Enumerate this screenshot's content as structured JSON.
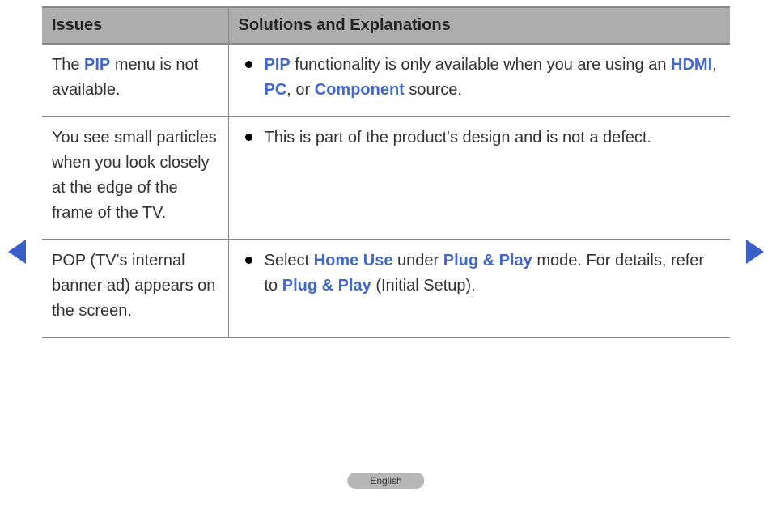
{
  "table": {
    "headers": {
      "issues": "Issues",
      "solutions": "Solutions and Explanations"
    },
    "rows": [
      {
        "issue_key": "pip-menu-not-available",
        "issue_segments": [
          {
            "text": "The ",
            "keyword": false
          },
          {
            "text": "PIP",
            "keyword": true
          },
          {
            "text": " menu is not available.",
            "keyword": false
          }
        ],
        "solution_segments": [
          {
            "text": "PIP",
            "keyword": true
          },
          {
            "text": " functionality is only available when you are using an ",
            "keyword": false
          },
          {
            "text": "HDMI",
            "keyword": true
          },
          {
            "text": ", ",
            "keyword": false
          },
          {
            "text": "PC",
            "keyword": true
          },
          {
            "text": ", or ",
            "keyword": false
          },
          {
            "text": "Component",
            "keyword": true
          },
          {
            "text": " source.",
            "keyword": false
          }
        ]
      },
      {
        "issue_key": "small-particles-frame",
        "issue_segments": [
          {
            "text": "You see small particles when you look closely at the edge of the frame of the TV.",
            "keyword": false
          }
        ],
        "solution_segments": [
          {
            "text": "This is part of the product's design and is not a defect.",
            "keyword": false
          }
        ]
      },
      {
        "issue_key": "pop-banner-ad",
        "issue_segments": [
          {
            "text": "POP (TV's internal banner ad) appears on the screen.",
            "keyword": false
          }
        ],
        "solution_segments": [
          {
            "text": "Select ",
            "keyword": false
          },
          {
            "text": "Home Use",
            "keyword": true
          },
          {
            "text": " under ",
            "keyword": false
          },
          {
            "text": "Plug & Play",
            "keyword": true
          },
          {
            "text": " mode. For details, refer to ",
            "keyword": false
          },
          {
            "text": "Plug & Play",
            "keyword": true
          },
          {
            "text": " (Initial Setup).",
            "keyword": false
          }
        ]
      }
    ]
  },
  "navigation": {
    "prev_label": "Previous page",
    "next_label": "Next page"
  },
  "language_badge": "English"
}
